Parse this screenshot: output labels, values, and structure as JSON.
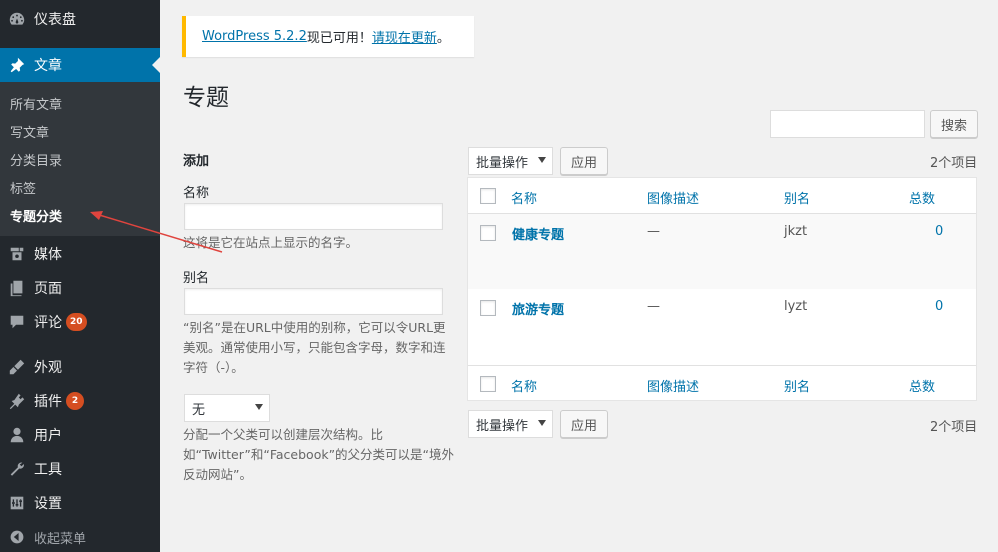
{
  "sidebar": {
    "items": [
      {
        "label": "仪表盘",
        "icon": "dashboard-icon"
      },
      {
        "label": "文章",
        "icon": "pin-icon"
      },
      {
        "label": "媒体",
        "icon": "media-icon"
      },
      {
        "label": "页面",
        "icon": "page-icon"
      },
      {
        "label": "评论",
        "icon": "comment-icon",
        "badge": "20"
      },
      {
        "label": "外观",
        "icon": "appearance-icon"
      },
      {
        "label": "插件",
        "icon": "plugin-icon",
        "badge": "2"
      },
      {
        "label": "用户",
        "icon": "user-icon"
      },
      {
        "label": "工具",
        "icon": "wrench-icon"
      },
      {
        "label": "设置",
        "icon": "settings-icon"
      }
    ],
    "submenu": [
      "所有文章",
      "写文章",
      "分类目录",
      "标签",
      "专题分类"
    ],
    "collapse_label": "收起菜单"
  },
  "notice": {
    "version_link": "WordPress 5.2.2",
    "middle": "现已可用！",
    "update_link": "请现在更新",
    "end": "。"
  },
  "page": {
    "title": "专题"
  },
  "search": {
    "button": "搜索"
  },
  "add_form": {
    "heading": "添加",
    "name_label": "名称",
    "name_desc": "这将是它在站点上显示的名字。",
    "slug_label": "别名",
    "slug_desc": "“别名”是在URL中使用的别称，它可以令URL更美观。通常使用小写，只能包含字母，数字和连字符（-）。",
    "parent_selected": "无",
    "parent_desc": "分配一个父类可以创建层次结构。比如“Twitter”和“Facebook”的父分类可以是“境外反动网站”。"
  },
  "bulk": {
    "select_label": "批量操作",
    "apply_label": "应用",
    "items_count": "2个项目"
  },
  "table": {
    "columns": [
      "名称",
      "图像描述",
      "别名",
      "总数"
    ],
    "rows": [
      {
        "name": "健康专题",
        "desc": "—",
        "slug": "jkzt",
        "count": "0"
      },
      {
        "name": "旅游专题",
        "desc": "—",
        "slug": "lyzt",
        "count": "0"
      }
    ]
  },
  "colors": {
    "sidebar_bg": "#23282d",
    "submenu_bg": "#32373c",
    "accent": "#0073aa",
    "badge": "#d54e21",
    "notice_border": "#ffb900",
    "annotation_arrow": "#e0443e"
  }
}
